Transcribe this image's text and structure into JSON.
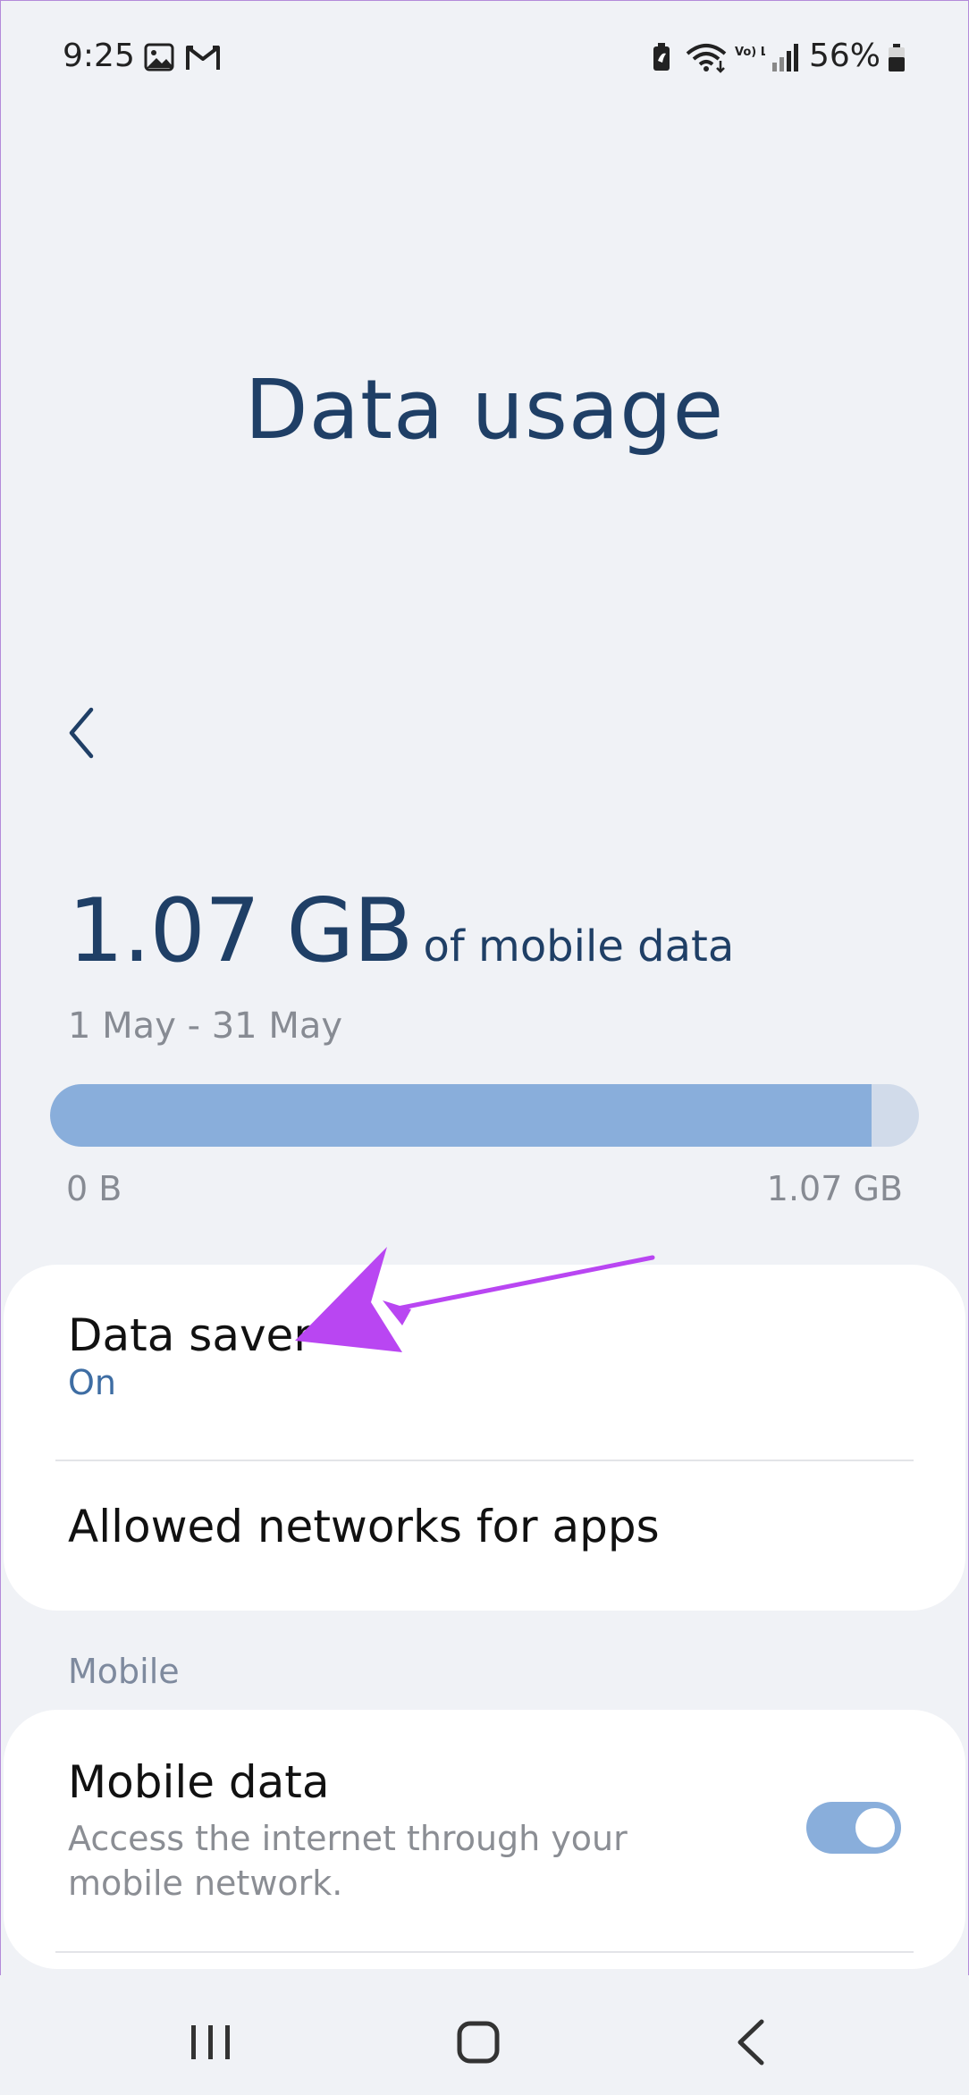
{
  "status_bar": {
    "time": "9:25",
    "battery": "56%",
    "icons": [
      "gallery-icon",
      "gmail-icon",
      "battery-saver-icon",
      "wifi-icon",
      "volte-icon",
      "signal-icon",
      "battery-icon"
    ],
    "volte_text": "Vo) LTE"
  },
  "page": {
    "title": "Data usage"
  },
  "usage": {
    "amount": "1.07 GB",
    "suffix": "of mobile data",
    "period": "1 May - 31 May",
    "bar_fill_fraction": 0.945,
    "bar_min_label": "0 B",
    "bar_max_label": "1.07 GB"
  },
  "settings_card": {
    "data_saver": {
      "title": "Data saver",
      "status": "On"
    },
    "allowed_networks": {
      "title": "Allowed networks for apps"
    }
  },
  "mobile_section": {
    "header": "Mobile",
    "mobile_data": {
      "title": "Mobile data",
      "description_line1": "Access the internet through your",
      "description_line2": "mobile network.",
      "enabled": true
    }
  },
  "colors": {
    "title": "#1f3f66",
    "accent": "#89aedb",
    "annotation_arrow": "#b946f2",
    "status_on": "#3e6da3"
  }
}
